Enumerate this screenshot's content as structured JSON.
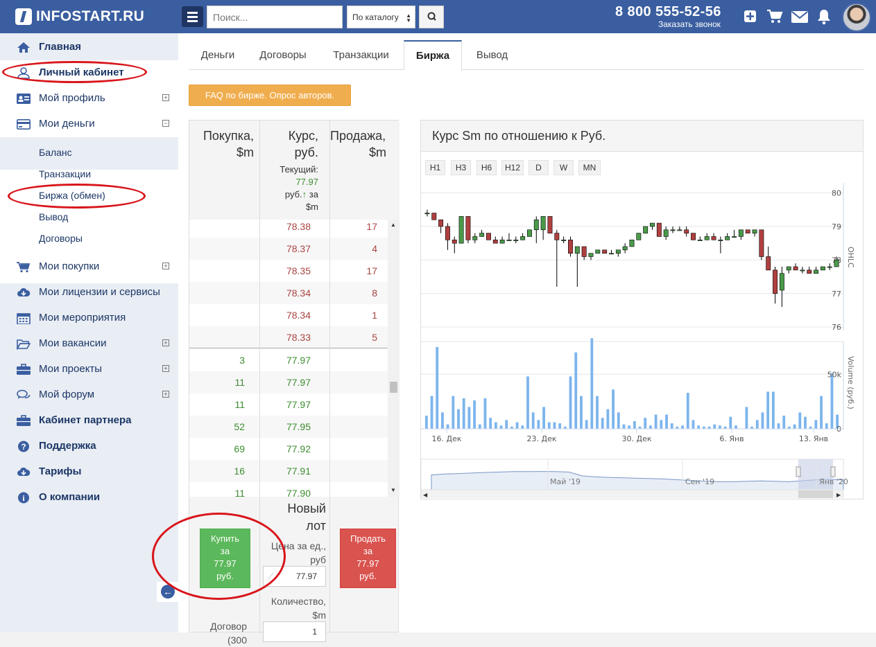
{
  "header": {
    "logo_text": "INFOSTART.RU",
    "search_placeholder": "Поиск...",
    "catalog_select": "По каталогу",
    "phone": "8 800 555-52-56",
    "callback": "Заказать звонок"
  },
  "sidebar": {
    "items": [
      {
        "label": "Главная",
        "icon": "home-icon"
      },
      {
        "label": "Личный кабинет",
        "icon": "user-icon"
      },
      {
        "label": "Мой профиль",
        "icon": "id-card-icon"
      },
      {
        "label": "Мои деньги",
        "icon": "credit-card-icon"
      },
      {
        "label": "Мои покупки",
        "icon": "cart-icon"
      },
      {
        "label": "Мои лицензии и сервисы",
        "icon": "cloud-download-icon"
      },
      {
        "label": "Мои мероприятия",
        "icon": "calendar-icon"
      },
      {
        "label": "Мои вакансии",
        "icon": "folder-open-icon"
      },
      {
        "label": "Мои проекты",
        "icon": "briefcase-icon"
      },
      {
        "label": "Мой форум",
        "icon": "comments-icon"
      },
      {
        "label": "Кабинет партнера",
        "icon": "briefcase-icon"
      },
      {
        "label": "Поддержка",
        "icon": "question-circle-icon"
      },
      {
        "label": "Тарифы",
        "icon": "cloud-download-icon"
      },
      {
        "label": "О компании",
        "icon": "info-circle-icon"
      }
    ],
    "money_sub": [
      "Баланс",
      "Транзакции",
      "Биржа (обмен)",
      "Вывод",
      "Договоры"
    ]
  },
  "tabs": [
    "Деньги",
    "Договоры",
    "Транзакции",
    "Биржа",
    "Вывод"
  ],
  "faq_button": "FAQ по бирже. Опрос авторов.",
  "orderbook": {
    "col_buy_1": "Покупка,",
    "col_buy_2": "$m",
    "col_rate_1": "Курс,",
    "col_rate_2": "руб.",
    "col_sell_1": "Продажа,",
    "col_sell_2": "$m",
    "current_label": "Текущий:",
    "current_value": "77.97",
    "current_unit": "руб.",
    "current_per": "за",
    "current_per_unit": "$m",
    "sell_rows": [
      {
        "rate": "78.38",
        "qty": "17"
      },
      {
        "rate": "78.37",
        "qty": "4"
      },
      {
        "rate": "78.35",
        "qty": "17"
      },
      {
        "rate": "78.34",
        "qty": "8"
      },
      {
        "rate": "78.34",
        "qty": "1"
      },
      {
        "rate": "78.33",
        "qty": "5"
      }
    ],
    "buy_rows": [
      {
        "qty": "3",
        "rate": "77.97"
      },
      {
        "qty": "11",
        "rate": "77.97"
      },
      {
        "qty": "11",
        "rate": "77.97"
      },
      {
        "qty": "52",
        "rate": "77.95"
      },
      {
        "qty": "69",
        "rate": "77.92"
      },
      {
        "qty": "16",
        "rate": "77.91"
      },
      {
        "qty": "11",
        "rate": "77.90"
      }
    ]
  },
  "lot": {
    "title_1": "Новый",
    "title_2": "лот",
    "price_label_1": "Цена за ед.,",
    "price_label_2": "руб",
    "price_value": "77.97",
    "qty_label_1": "Количество,",
    "qty_label_2": "$m",
    "qty_value": "1",
    "buy_button": [
      "Купить",
      "за",
      "77.97",
      "руб."
    ],
    "sell_button": [
      "Продать",
      "за",
      "77.97",
      "руб."
    ],
    "contract_1": "Договор",
    "contract_2": "(300"
  },
  "chart_panel": {
    "title": "Курс Sm по отношению к Руб.",
    "timeframes": [
      "H1",
      "H3",
      "H6",
      "H12",
      "D",
      "W",
      "MN"
    ]
  },
  "chart_data": {
    "type": "candlestick",
    "ohlc_axis_label": "OHLC",
    "volume_axis_label": "Volume (руб.)",
    "y_ticks": [
      "80",
      "79",
      "78",
      "77",
      "76"
    ],
    "ylim": [
      75.9,
      80.3
    ],
    "volume_ticks": [
      "50k",
      "0"
    ],
    "volume_max": 80000,
    "x_ticks": [
      "16. Дек",
      "23. Дек",
      "30. Дек",
      "6. Янв",
      "13. Янв"
    ],
    "navigator_ticks": [
      "Май '19",
      "Сен '19",
      "Янв '20"
    ],
    "candles": [
      {
        "o": 79.4,
        "h": 79.5,
        "l": 79.3,
        "c": 79.4
      },
      {
        "o": 79.4,
        "h": 79.4,
        "l": 79.2,
        "c": 79.2
      },
      {
        "o": 79.2,
        "h": 79.2,
        "l": 78.8,
        "c": 79.0
      },
      {
        "o": 79.0,
        "h": 79.1,
        "l": 78.3,
        "c": 78.6
      },
      {
        "o": 78.6,
        "h": 78.7,
        "l": 78.2,
        "c": 78.5
      },
      {
        "o": 78.5,
        "h": 79.3,
        "l": 78.5,
        "c": 79.3
      },
      {
        "o": 79.3,
        "h": 79.3,
        "l": 78.5,
        "c": 78.6
      },
      {
        "o": 78.6,
        "h": 78.8,
        "l": 78.5,
        "c": 78.7
      },
      {
        "o": 78.7,
        "h": 78.9,
        "l": 78.7,
        "c": 78.8
      },
      {
        "o": 78.8,
        "h": 78.8,
        "l": 78.6,
        "c": 78.6
      },
      {
        "o": 78.6,
        "h": 78.7,
        "l": 78.5,
        "c": 78.5
      },
      {
        "o": 78.5,
        "h": 78.7,
        "l": 78.5,
        "c": 78.6
      },
      {
        "o": 78.6,
        "h": 78.8,
        "l": 78.6,
        "c": 78.6
      },
      {
        "o": 78.6,
        "h": 78.7,
        "l": 78.5,
        "c": 78.6
      },
      {
        "o": 78.6,
        "h": 78.8,
        "l": 78.6,
        "c": 78.7
      },
      {
        "o": 78.7,
        "h": 78.9,
        "l": 78.7,
        "c": 78.9
      },
      {
        "o": 78.9,
        "h": 79.3,
        "l": 78.5,
        "c": 79.2
      },
      {
        "o": 78.9,
        "h": 79.3,
        "l": 78.6,
        "c": 79.3
      },
      {
        "o": 79.3,
        "h": 79.3,
        "l": 78.8,
        "c": 78.8
      },
      {
        "o": 78.8,
        "h": 78.9,
        "l": 77.2,
        "c": 78.6
      },
      {
        "o": 78.6,
        "h": 78.7,
        "l": 78.5,
        "c": 78.6
      },
      {
        "o": 78.6,
        "h": 78.7,
        "l": 78.1,
        "c": 78.2
      },
      {
        "o": 78.2,
        "h": 78.4,
        "l": 77.2,
        "c": 78.4
      },
      {
        "o": 78.4,
        "h": 78.4,
        "l": 78.0,
        "c": 78.1
      },
      {
        "o": 78.1,
        "h": 78.2,
        "l": 78.0,
        "c": 78.2
      },
      {
        "o": 78.2,
        "h": 78.3,
        "l": 78.2,
        "c": 78.3
      },
      {
        "o": 78.3,
        "h": 78.3,
        "l": 78.2,
        "c": 78.2
      },
      {
        "o": 78.2,
        "h": 78.3,
        "l": 78.2,
        "c": 78.2
      },
      {
        "o": 78.2,
        "h": 78.3,
        "l": 78.1,
        "c": 78.3
      },
      {
        "o": 78.3,
        "h": 78.5,
        "l": 78.2,
        "c": 78.4
      },
      {
        "o": 78.4,
        "h": 78.6,
        "l": 78.4,
        "c": 78.6
      },
      {
        "o": 78.6,
        "h": 78.8,
        "l": 78.6,
        "c": 78.8
      },
      {
        "o": 78.8,
        "h": 79.0,
        "l": 78.8,
        "c": 79.0
      },
      {
        "o": 79.0,
        "h": 79.1,
        "l": 78.9,
        "c": 79.1
      },
      {
        "o": 79.1,
        "h": 79.1,
        "l": 78.7,
        "c": 78.7
      },
      {
        "o": 78.7,
        "h": 79.0,
        "l": 78.6,
        "c": 78.9
      },
      {
        "o": 78.9,
        "h": 79.0,
        "l": 78.8,
        "c": 78.9
      },
      {
        "o": 78.9,
        "h": 79.0,
        "l": 78.9,
        "c": 78.9
      },
      {
        "o": 78.9,
        "h": 79.0,
        "l": 78.7,
        "c": 78.8
      },
      {
        "o": 78.8,
        "h": 78.8,
        "l": 78.6,
        "c": 78.6
      },
      {
        "o": 78.6,
        "h": 78.7,
        "l": 78.6,
        "c": 78.6
      },
      {
        "o": 78.6,
        "h": 78.8,
        "l": 78.6,
        "c": 78.7
      },
      {
        "o": 78.7,
        "h": 78.8,
        "l": 78.6,
        "c": 78.6
      },
      {
        "o": 78.6,
        "h": 78.7,
        "l": 78.2,
        "c": 78.6
      },
      {
        "o": 78.6,
        "h": 78.8,
        "l": 78.6,
        "c": 78.7
      },
      {
        "o": 78.7,
        "h": 78.9,
        "l": 78.7,
        "c": 78.7
      },
      {
        "o": 78.7,
        "h": 78.9,
        "l": 78.6,
        "c": 78.9
      },
      {
        "o": 78.9,
        "h": 78.9,
        "l": 78.8,
        "c": 78.8
      },
      {
        "o": 78.8,
        "h": 78.9,
        "l": 78.7,
        "c": 78.9
      },
      {
        "o": 78.9,
        "h": 78.9,
        "l": 78.0,
        "c": 78.1
      },
      {
        "o": 78.1,
        "h": 78.4,
        "l": 77.7,
        "c": 77.7
      },
      {
        "o": 77.7,
        "h": 77.8,
        "l": 76.7,
        "c": 77.0
      },
      {
        "o": 77.1,
        "h": 77.8,
        "l": 76.6,
        "c": 77.6
      },
      {
        "o": 77.7,
        "h": 77.8,
        "l": 77.6,
        "c": 77.8
      },
      {
        "o": 77.8,
        "h": 77.9,
        "l": 77.7,
        "c": 77.7
      },
      {
        "o": 77.7,
        "h": 77.8,
        "l": 77.6,
        "c": 77.7
      },
      {
        "o": 77.7,
        "h": 77.8,
        "l": 77.6,
        "c": 77.6
      },
      {
        "o": 77.6,
        "h": 77.8,
        "l": 77.6,
        "c": 77.7
      },
      {
        "o": 77.7,
        "h": 77.8,
        "l": 77.7,
        "c": 77.8
      },
      {
        "o": 77.8,
        "h": 77.9,
        "l": 77.7,
        "c": 77.8
      },
      {
        "o": 77.8,
        "h": 78.1,
        "l": 77.8,
        "c": 78.0
      }
    ],
    "volumes": [
      12000,
      30000,
      75000,
      15000,
      4000,
      30000,
      18000,
      28000,
      20000,
      26000,
      4000,
      28000,
      10000,
      6000,
      3000,
      8000,
      2000,
      6000,
      3000,
      48000,
      15000,
      8000,
      20000,
      6000,
      6000,
      5000,
      2000,
      48000,
      70000,
      30000,
      8000,
      83000,
      30000,
      10000,
      18000,
      36000,
      15000,
      4000,
      3000,
      7000,
      2000,
      10000,
      3000,
      13000,
      8000,
      13000,
      5000,
      2000,
      3000,
      33000,
      8000,
      3000,
      2000,
      2000,
      4000,
      3000,
      2000,
      11000,
      3000,
      0,
      20000,
      2000,
      8000,
      15000,
      34000,
      34000,
      5000,
      12000,
      2000,
      4000,
      15000,
      11000,
      2000,
      8000,
      30000,
      5000,
      51000,
      13000
    ]
  }
}
